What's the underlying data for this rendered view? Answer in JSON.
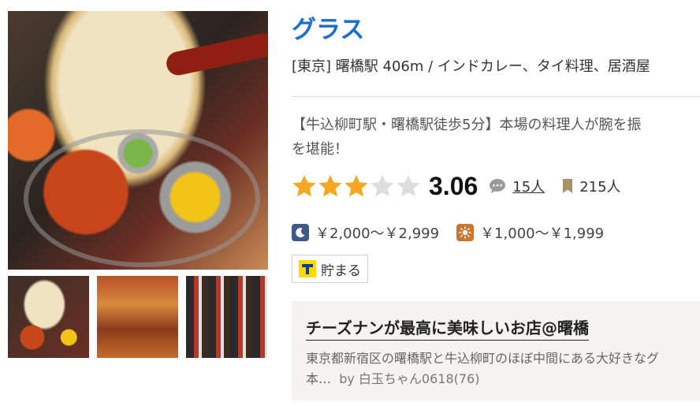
{
  "shop": {
    "name": "グラス",
    "area_genre": "[東京] 曙橋駅 406m / インドカレー、タイ料理、居酒屋",
    "pr_line1": "【牛込柳町駅・曙橋駅徒歩5分】本場の料理人が腕を振",
    "pr_line2": "を堪能！"
  },
  "rating": {
    "score": "3.06",
    "stars_filled": 3,
    "stars_total": 5,
    "review_count": "15人",
    "save_count": "215人",
    "colors": {
      "star_on": "#f5a623",
      "star_off": "#dddddd"
    }
  },
  "prices": {
    "dinner": "￥2,000～￥2,999",
    "lunch": "￥1,000～￥1,999"
  },
  "tpoint": {
    "label": "貯まる"
  },
  "review": {
    "title": "チーズナンが最高に美味しいお店@曙橋",
    "body_line1": "東京都新宿区の曙橋駅と牛込柳町のほぼ中間にある大好きなグ",
    "body_line2": "本…",
    "by": "by 白玉ちゃん0618(76)"
  },
  "icons": {
    "review": "speech-bubble-icon",
    "save": "bookmark-icon",
    "dinner": "moon-icon",
    "lunch": "sun-icon",
    "tpoint": "tpoint-logo"
  },
  "colors": {
    "brand_link": "#1b6dd1"
  }
}
